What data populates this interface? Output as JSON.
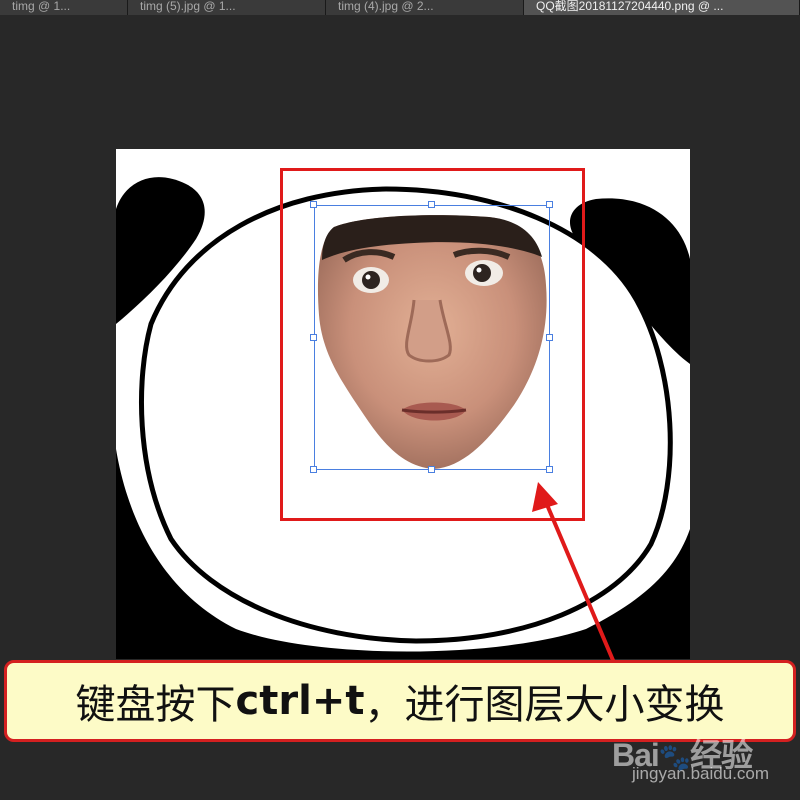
{
  "tabs": [
    {
      "label": "timg @ 1...",
      "active": false
    },
    {
      "label": "timg (5).jpg @ 1...",
      "active": false
    },
    {
      "label": "timg (4).jpg @ 2...",
      "active": false
    },
    {
      "label": "QQ截图20181127204440.png @ ...",
      "active": true
    }
  ],
  "tab_close_glyph": "×",
  "caption": {
    "part1": "键盘按下",
    "shortcut": "ctrl+t",
    "part2": "，进行图层大小变换"
  },
  "watermark": {
    "logo_left": "Bai",
    "logo_paw": "🐾",
    "logo_right": "经验",
    "site": "jingyan.baidu.com"
  },
  "colors": {
    "workspace": "#282828",
    "highlight": "#e01a1a",
    "transform_box": "#4a7fe0",
    "caption_bg": "#fdfbc7"
  }
}
